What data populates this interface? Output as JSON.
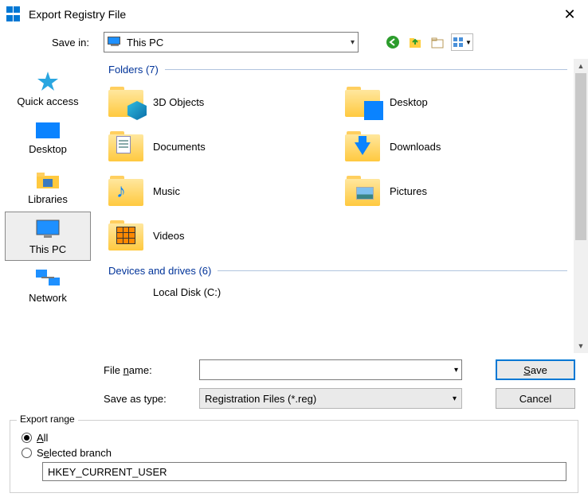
{
  "title": "Export Registry File",
  "save_in": {
    "label": "Save in:",
    "value": "This PC"
  },
  "tool_icons": [
    "back-icon",
    "up-icon",
    "new-folder-icon",
    "view-icon"
  ],
  "sidebar": {
    "items": [
      {
        "label": "Quick access"
      },
      {
        "label": "Desktop"
      },
      {
        "label": "Libraries"
      },
      {
        "label": "This PC"
      },
      {
        "label": "Network"
      }
    ],
    "selected_index": 3
  },
  "sections": {
    "folders": {
      "header": "Folders (7)",
      "items": [
        "3D Objects",
        "Desktop",
        "Documents",
        "Downloads",
        "Music",
        "Pictures",
        "Videos"
      ]
    },
    "drives": {
      "header": "Devices and drives (6)",
      "items": [
        "Local Disk (C:)"
      ]
    }
  },
  "filename": {
    "label": "File name:",
    "value": ""
  },
  "save_type": {
    "label": "Save as type:",
    "value": "Registration Files (*.reg)"
  },
  "buttons": {
    "save": "Save",
    "cancel": "Cancel"
  },
  "export_range": {
    "legend": "Export range",
    "all_label": "All",
    "selected_label": "Selected branch",
    "selected": "all",
    "branch_value": "HKEY_CURRENT_USER"
  }
}
